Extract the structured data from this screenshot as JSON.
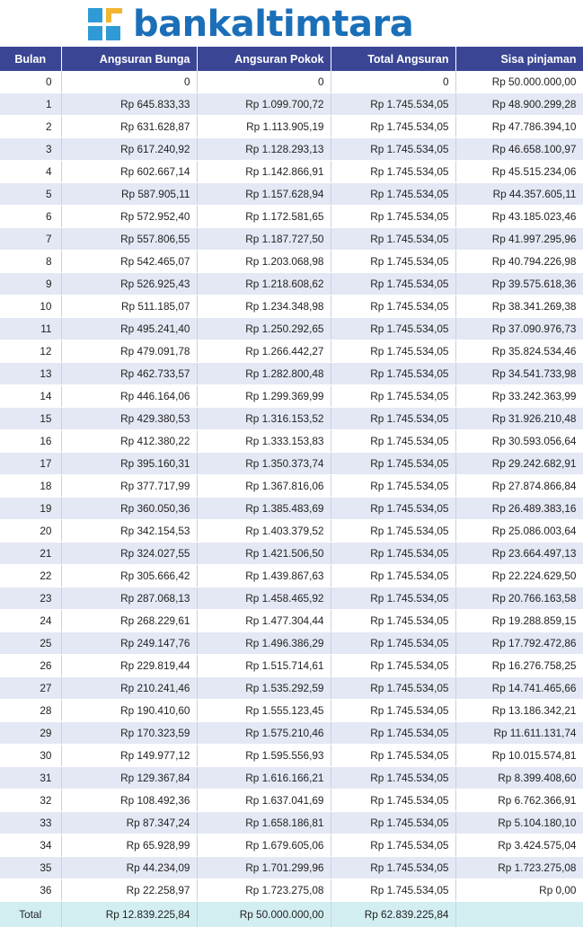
{
  "brand": {
    "name": "bankaltimtara",
    "text_color": "#1b6fb8",
    "mark_colors": [
      "#2f9bd6",
      "#f2b632"
    ]
  },
  "colors": {
    "header_bg": "#3a4694",
    "total_row_bg": "#d3eef1",
    "stripe_bg": "#e4e8f4"
  },
  "table": {
    "headers": [
      "Bulan",
      "Angsuran Bunga",
      "Angsuran Pokok",
      "Total Angsuran",
      "Sisa pinjaman"
    ],
    "rows": [
      [
        "0",
        "0",
        "0",
        "0",
        "Rp 50.000.000,00"
      ],
      [
        "1",
        "Rp 645.833,33",
        "Rp 1.099.700,72",
        "Rp 1.745.534,05",
        "Rp 48.900.299,28"
      ],
      [
        "2",
        "Rp 631.628,87",
        "Rp 1.113.905,19",
        "Rp 1.745.534,05",
        "Rp 47.786.394,10"
      ],
      [
        "3",
        "Rp 617.240,92",
        "Rp 1.128.293,13",
        "Rp 1.745.534,05",
        "Rp 46.658.100,97"
      ],
      [
        "4",
        "Rp 602.667,14",
        "Rp 1.142.866,91",
        "Rp 1.745.534,05",
        "Rp 45.515.234,06"
      ],
      [
        "5",
        "Rp 587.905,11",
        "Rp 1.157.628,94",
        "Rp 1.745.534,05",
        "Rp 44.357.605,11"
      ],
      [
        "6",
        "Rp 572.952,40",
        "Rp 1.172.581,65",
        "Rp 1.745.534,05",
        "Rp 43.185.023,46"
      ],
      [
        "7",
        "Rp 557.806,55",
        "Rp 1.187.727,50",
        "Rp 1.745.534,05",
        "Rp 41.997.295,96"
      ],
      [
        "8",
        "Rp 542.465,07",
        "Rp 1.203.068,98",
        "Rp 1.745.534,05",
        "Rp 40.794.226,98"
      ],
      [
        "9",
        "Rp 526.925,43",
        "Rp 1.218.608,62",
        "Rp 1.745.534,05",
        "Rp 39.575.618,36"
      ],
      [
        "10",
        "Rp 511.185,07",
        "Rp 1.234.348,98",
        "Rp 1.745.534,05",
        "Rp 38.341.269,38"
      ],
      [
        "11",
        "Rp 495.241,40",
        "Rp 1.250.292,65",
        "Rp 1.745.534,05",
        "Rp 37.090.976,73"
      ],
      [
        "12",
        "Rp 479.091,78",
        "Rp 1.266.442,27",
        "Rp 1.745.534,05",
        "Rp 35.824.534,46"
      ],
      [
        "13",
        "Rp 462.733,57",
        "Rp 1.282.800,48",
        "Rp 1.745.534,05",
        "Rp 34.541.733,98"
      ],
      [
        "14",
        "Rp 446.164,06",
        "Rp 1.299.369,99",
        "Rp 1.745.534,05",
        "Rp 33.242.363,99"
      ],
      [
        "15",
        "Rp 429.380,53",
        "Rp 1.316.153,52",
        "Rp 1.745.534,05",
        "Rp 31.926.210,48"
      ],
      [
        "16",
        "Rp 412.380,22",
        "Rp 1.333.153,83",
        "Rp 1.745.534,05",
        "Rp 30.593.056,64"
      ],
      [
        "17",
        "Rp 395.160,31",
        "Rp 1.350.373,74",
        "Rp 1.745.534,05",
        "Rp 29.242.682,91"
      ],
      [
        "18",
        "Rp 377.717,99",
        "Rp 1.367.816,06",
        "Rp 1.745.534,05",
        "Rp 27.874.866,84"
      ],
      [
        "19",
        "Rp 360.050,36",
        "Rp 1.385.483,69",
        "Rp 1.745.534,05",
        "Rp 26.489.383,16"
      ],
      [
        "20",
        "Rp 342.154,53",
        "Rp 1.403.379,52",
        "Rp 1.745.534,05",
        "Rp 25.086.003,64"
      ],
      [
        "21",
        "Rp 324.027,55",
        "Rp 1.421.506,50",
        "Rp 1.745.534,05",
        "Rp 23.664.497,13"
      ],
      [
        "22",
        "Rp 305.666,42",
        "Rp 1.439.867,63",
        "Rp 1.745.534,05",
        "Rp 22.224.629,50"
      ],
      [
        "23",
        "Rp 287.068,13",
        "Rp 1.458.465,92",
        "Rp 1.745.534,05",
        "Rp 20.766.163,58"
      ],
      [
        "24",
        "Rp 268.229,61",
        "Rp 1.477.304,44",
        "Rp 1.745.534,05",
        "Rp 19.288.859,15"
      ],
      [
        "25",
        "Rp 249.147,76",
        "Rp 1.496.386,29",
        "Rp 1.745.534,05",
        "Rp 17.792.472,86"
      ],
      [
        "26",
        "Rp 229.819,44",
        "Rp 1.515.714,61",
        "Rp 1.745.534,05",
        "Rp 16.276.758,25"
      ],
      [
        "27",
        "Rp 210.241,46",
        "Rp 1.535.292,59",
        "Rp 1.745.534,05",
        "Rp 14.741.465,66"
      ],
      [
        "28",
        "Rp 190.410,60",
        "Rp 1.555.123,45",
        "Rp 1.745.534,05",
        "Rp 13.186.342,21"
      ],
      [
        "29",
        "Rp 170.323,59",
        "Rp 1.575.210,46",
        "Rp 1.745.534,05",
        "Rp 11.611.131,74"
      ],
      [
        "30",
        "Rp 149.977,12",
        "Rp 1.595.556,93",
        "Rp 1.745.534,05",
        "Rp 10.015.574,81"
      ],
      [
        "31",
        "Rp 129.367,84",
        "Rp 1.616.166,21",
        "Rp 1.745.534,05",
        "Rp 8.399.408,60"
      ],
      [
        "32",
        "Rp 108.492,36",
        "Rp 1.637.041,69",
        "Rp 1.745.534,05",
        "Rp 6.762.366,91"
      ],
      [
        "33",
        "Rp 87.347,24",
        "Rp 1.658.186,81",
        "Rp 1.745.534,05",
        "Rp 5.104.180,10"
      ],
      [
        "34",
        "Rp 65.928,99",
        "Rp 1.679.605,06",
        "Rp 1.745.534,05",
        "Rp 3.424.575,04"
      ],
      [
        "35",
        "Rp 44.234,09",
        "Rp 1.701.299,96",
        "Rp 1.745.534,05",
        "Rp 1.723.275,08"
      ],
      [
        "36",
        "Rp 22.258,97",
        "Rp 1.723.275,08",
        "Rp 1.745.534,05",
        "Rp 0,00"
      ]
    ],
    "total": [
      "Total",
      "Rp 12.839.225,84",
      "Rp 50.000.000,00",
      "Rp 62.839.225,84",
      ""
    ]
  }
}
